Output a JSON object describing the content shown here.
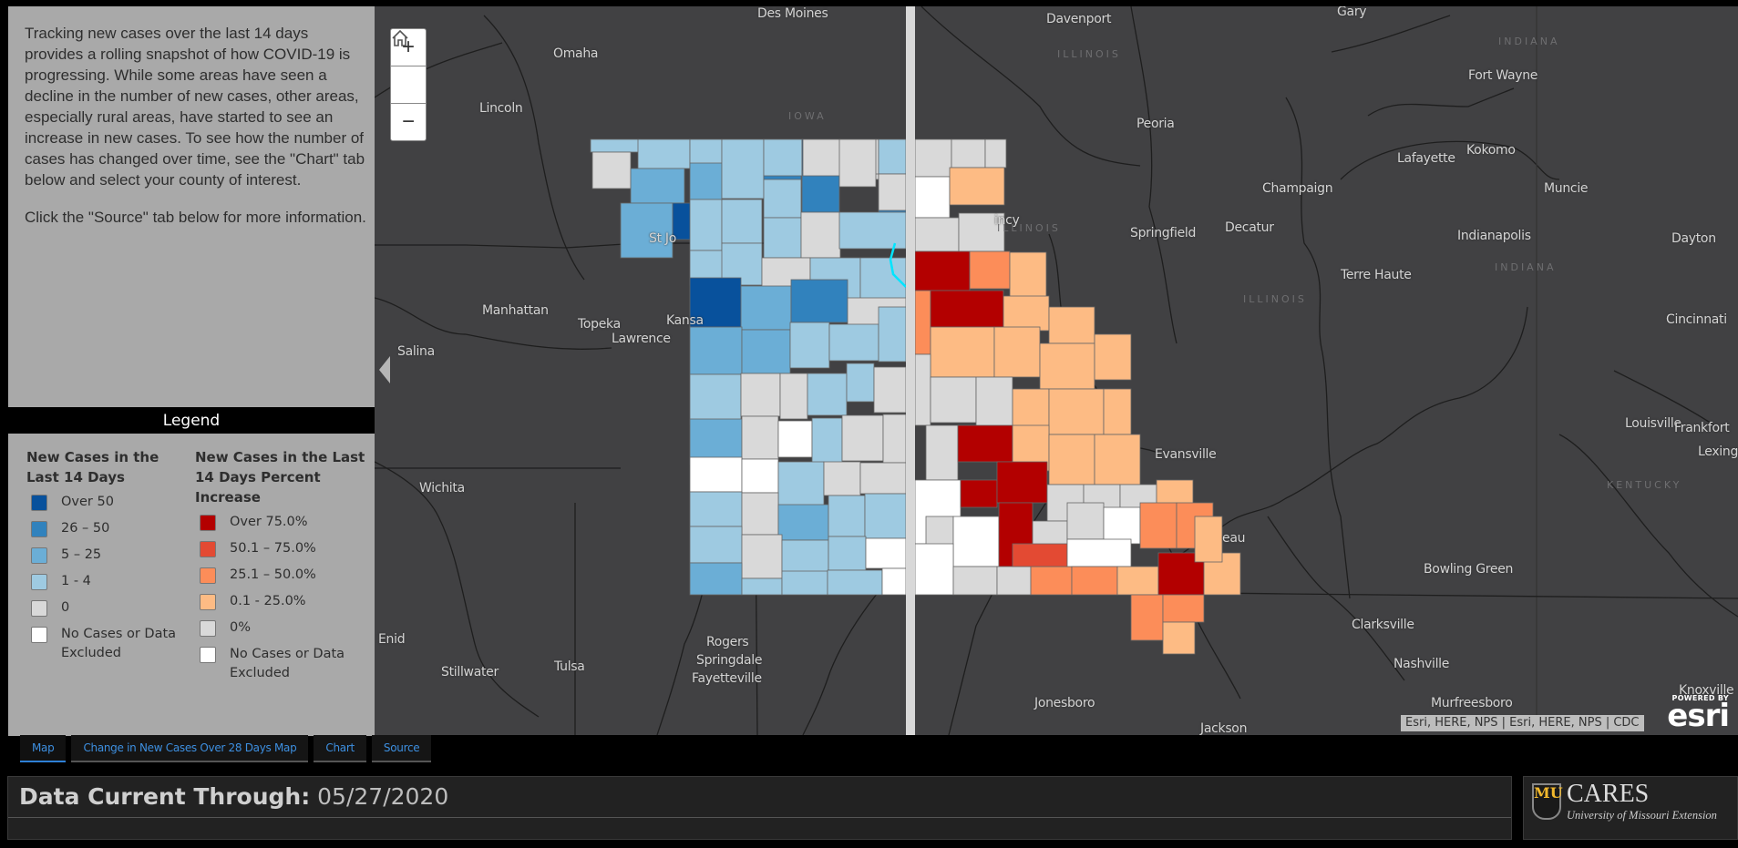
{
  "info": {
    "paragraphs": [
      "Tracking new cases over the last 14 days provides a rolling snapshot of how COVID-19 is progressing. While some areas have seen a decline in the number of new cases, other areas, especially rural areas, have started to see an increase in new cases. To see how the number of cases has changed over time, see the \"Chart\" tab below and select your county of interest.",
      "Click the \"Source\" tab below for more information."
    ]
  },
  "legend": {
    "header": "Legend",
    "left": {
      "title": "New Cases in the Last 14 Days",
      "items": [
        {
          "label": "Over 50",
          "color": "#08519c"
        },
        {
          "label": "26 – 50",
          "color": "#3182bd"
        },
        {
          "label": "5 – 25",
          "color": "#6baed6"
        },
        {
          "label": "1 - 4",
          "color": "#9ecae1"
        },
        {
          "label": "0",
          "color": "#d9d9d9"
        },
        {
          "label": "No Cases or Data Excluded",
          "color": "#ffffff"
        }
      ]
    },
    "right": {
      "title": "New Cases in the Last 14 Days Percent Increase",
      "items": [
        {
          "label": "Over 75.0%",
          "color": "#b30000"
        },
        {
          "label": "50.1 – 75.0%",
          "color": "#e34a33"
        },
        {
          "label": "25.1 – 50.0%",
          "color": "#fc8d59"
        },
        {
          "label": "0.1 - 25.0%",
          "color": "#fdbb84"
        },
        {
          "label": "0%",
          "color": "#d9d9d9"
        },
        {
          "label": "No Cases or Data Excluded",
          "color": "#ffffff"
        }
      ]
    }
  },
  "map": {
    "zoom_in_icon": "+",
    "home_icon": "⌂",
    "zoom_out_icon": "−",
    "attribution": "Esri, HERE, NPS | Esri, HERE, NPS | CDC",
    "esri_powered": "POWERED BY",
    "esri_word": "esri",
    "cities": [
      {
        "name": "Des Moines"
      },
      {
        "name": "Davenport"
      },
      {
        "name": "Gary"
      },
      {
        "name": "Omaha"
      },
      {
        "name": "Fort Wayne"
      },
      {
        "name": "Lincoln"
      },
      {
        "name": "Peoria"
      },
      {
        "name": "Lafayette"
      },
      {
        "name": "Kokomo"
      },
      {
        "name": "Champaign"
      },
      {
        "name": "Muncie"
      },
      {
        "name": "Springfield"
      },
      {
        "name": "Decatur"
      },
      {
        "name": "Indianapolis"
      },
      {
        "name": "Dayton"
      },
      {
        "name": "Terre Haute"
      },
      {
        "name": "Manhattan"
      },
      {
        "name": "Topeka"
      },
      {
        "name": "Lawrence"
      },
      {
        "name": "Salina"
      },
      {
        "name": "Cincinnati"
      },
      {
        "name": "Louisville"
      },
      {
        "name": "Frankfort"
      },
      {
        "name": "Lexington"
      },
      {
        "name": "Evansville"
      },
      {
        "name": "Wichita"
      },
      {
        "name": "Bowling Green"
      },
      {
        "name": "Clarksville"
      },
      {
        "name": "Enid"
      },
      {
        "name": "Stillwater"
      },
      {
        "name": "Tulsa"
      },
      {
        "name": "Rogers"
      },
      {
        "name": "Springdale"
      },
      {
        "name": "Fayetteville"
      },
      {
        "name": "Nashville"
      },
      {
        "name": "Jonesboro"
      },
      {
        "name": "Murfreesboro"
      },
      {
        "name": "Knoxville"
      },
      {
        "name": "Jackson"
      },
      {
        "name": "St Jo"
      },
      {
        "name": "Kansa"
      },
      {
        "name": "incy"
      },
      {
        "name": "eau"
      }
    ],
    "states": [
      {
        "name": "IOWA"
      },
      {
        "name": "ILLINOIS"
      },
      {
        "name": "ILLINOIS"
      },
      {
        "name": "ILLINOIS"
      },
      {
        "name": "INDIANA"
      },
      {
        "name": "INDIANA"
      },
      {
        "name": "KENTUCKY"
      }
    ],
    "left_layer_classes": [
      "Over 50",
      "26 – 50",
      "5 – 25",
      "1 - 4",
      "0",
      "No Cases or Data Excluded"
    ],
    "right_layer_classes": [
      "Over 75.0%",
      "50.1 – 75.0%",
      "25.1 – 50.0%",
      "0.1 - 25.0%",
      "0%",
      "No Cases or Data Excluded"
    ]
  },
  "tabs": [
    {
      "label": "Map",
      "active": true
    },
    {
      "label": "Change in New Cases Over 28 Days Map",
      "active": false
    },
    {
      "label": "Chart",
      "active": false
    },
    {
      "label": "Source",
      "active": false
    }
  ],
  "footer": {
    "date_label": "Data Current Through:",
    "date_value": "05/27/2020",
    "logo_mark": "MU",
    "logo_title": "CARES",
    "logo_subtitle": "University of Missouri Extension"
  }
}
